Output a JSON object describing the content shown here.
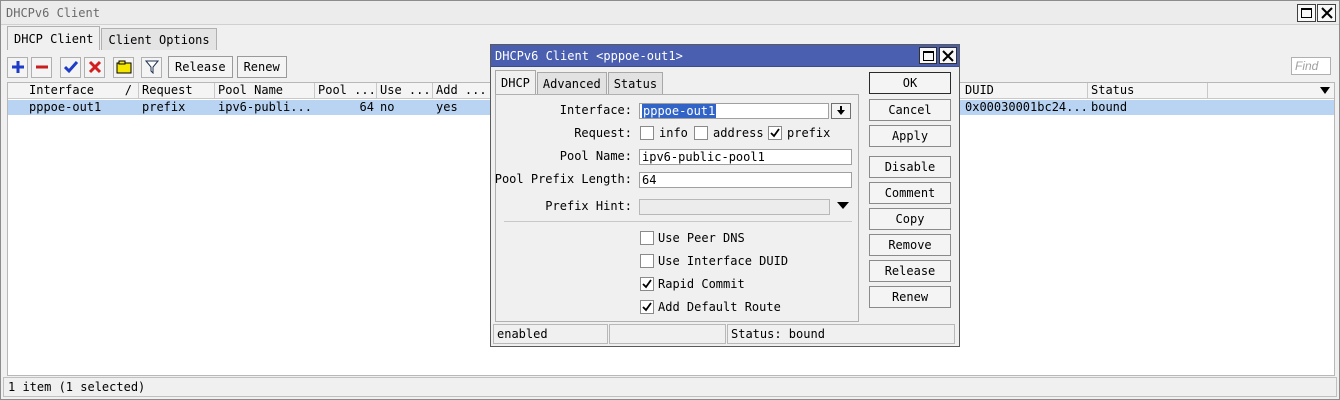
{
  "window": {
    "title": "DHCPv6 Client"
  },
  "tabs": [
    {
      "label": "DHCP Client"
    },
    {
      "label": "Client Options"
    }
  ],
  "toolbar": {
    "release_label": "Release",
    "renew_label": "Renew",
    "find_placeholder": "Find"
  },
  "table": {
    "columns": [
      "Interface",
      "Request",
      "Pool Name",
      "Pool ...",
      "Use ...",
      "Add ...",
      "DUID",
      "Status"
    ],
    "sort_indicator": "/",
    "rows": [
      {
        "interface": "pppoe-out1",
        "request": "prefix",
        "pool_name": "ipv6-publi...",
        "pool_len": "64",
        "use_peer_dns": "no",
        "add_route": "yes",
        "duid": "0x00030001bc24...",
        "status": "bound"
      }
    ]
  },
  "statusbar": {
    "text": "1 item (1 selected)"
  },
  "dialog": {
    "title": "DHCPv6 Client <pppoe-out1>",
    "tabs": [
      "DHCP",
      "Advanced",
      "Status"
    ],
    "fields": {
      "interface_label": "Interface:",
      "interface_value": "pppoe-out1",
      "request_label": "Request:",
      "request_info": "info",
      "request_address": "address",
      "request_prefix": "prefix",
      "pool_name_label": "Pool Name:",
      "pool_name_value": "ipv6-public-pool1",
      "pool_prefix_length_label": "Pool Prefix Length:",
      "pool_prefix_length_value": "64",
      "prefix_hint_label": "Prefix Hint:",
      "use_peer_dns": "Use Peer DNS",
      "use_interface_duid": "Use Interface DUID",
      "rapid_commit": "Rapid Commit",
      "add_default_route": "Add Default Route"
    },
    "checks": {
      "info": false,
      "address": false,
      "prefix": true,
      "use_peer_dns": false,
      "use_interface_duid": false,
      "rapid_commit": true,
      "add_default_route": true
    },
    "buttons": [
      "OK",
      "Cancel",
      "Apply",
      "Disable",
      "Comment",
      "Copy",
      "Remove",
      "Release",
      "Renew"
    ],
    "status": {
      "state": "enabled",
      "middle": "",
      "status_text": "Status: bound"
    }
  },
  "colors": {
    "dialog_title_bar": "#4a5fb0",
    "selected_row": "#b9d3f2",
    "add_icon": "#1e3cc8",
    "remove_icon": "#c81e1e",
    "check_icon": "#1e3cc8",
    "cross_icon": "#d21e1e"
  }
}
